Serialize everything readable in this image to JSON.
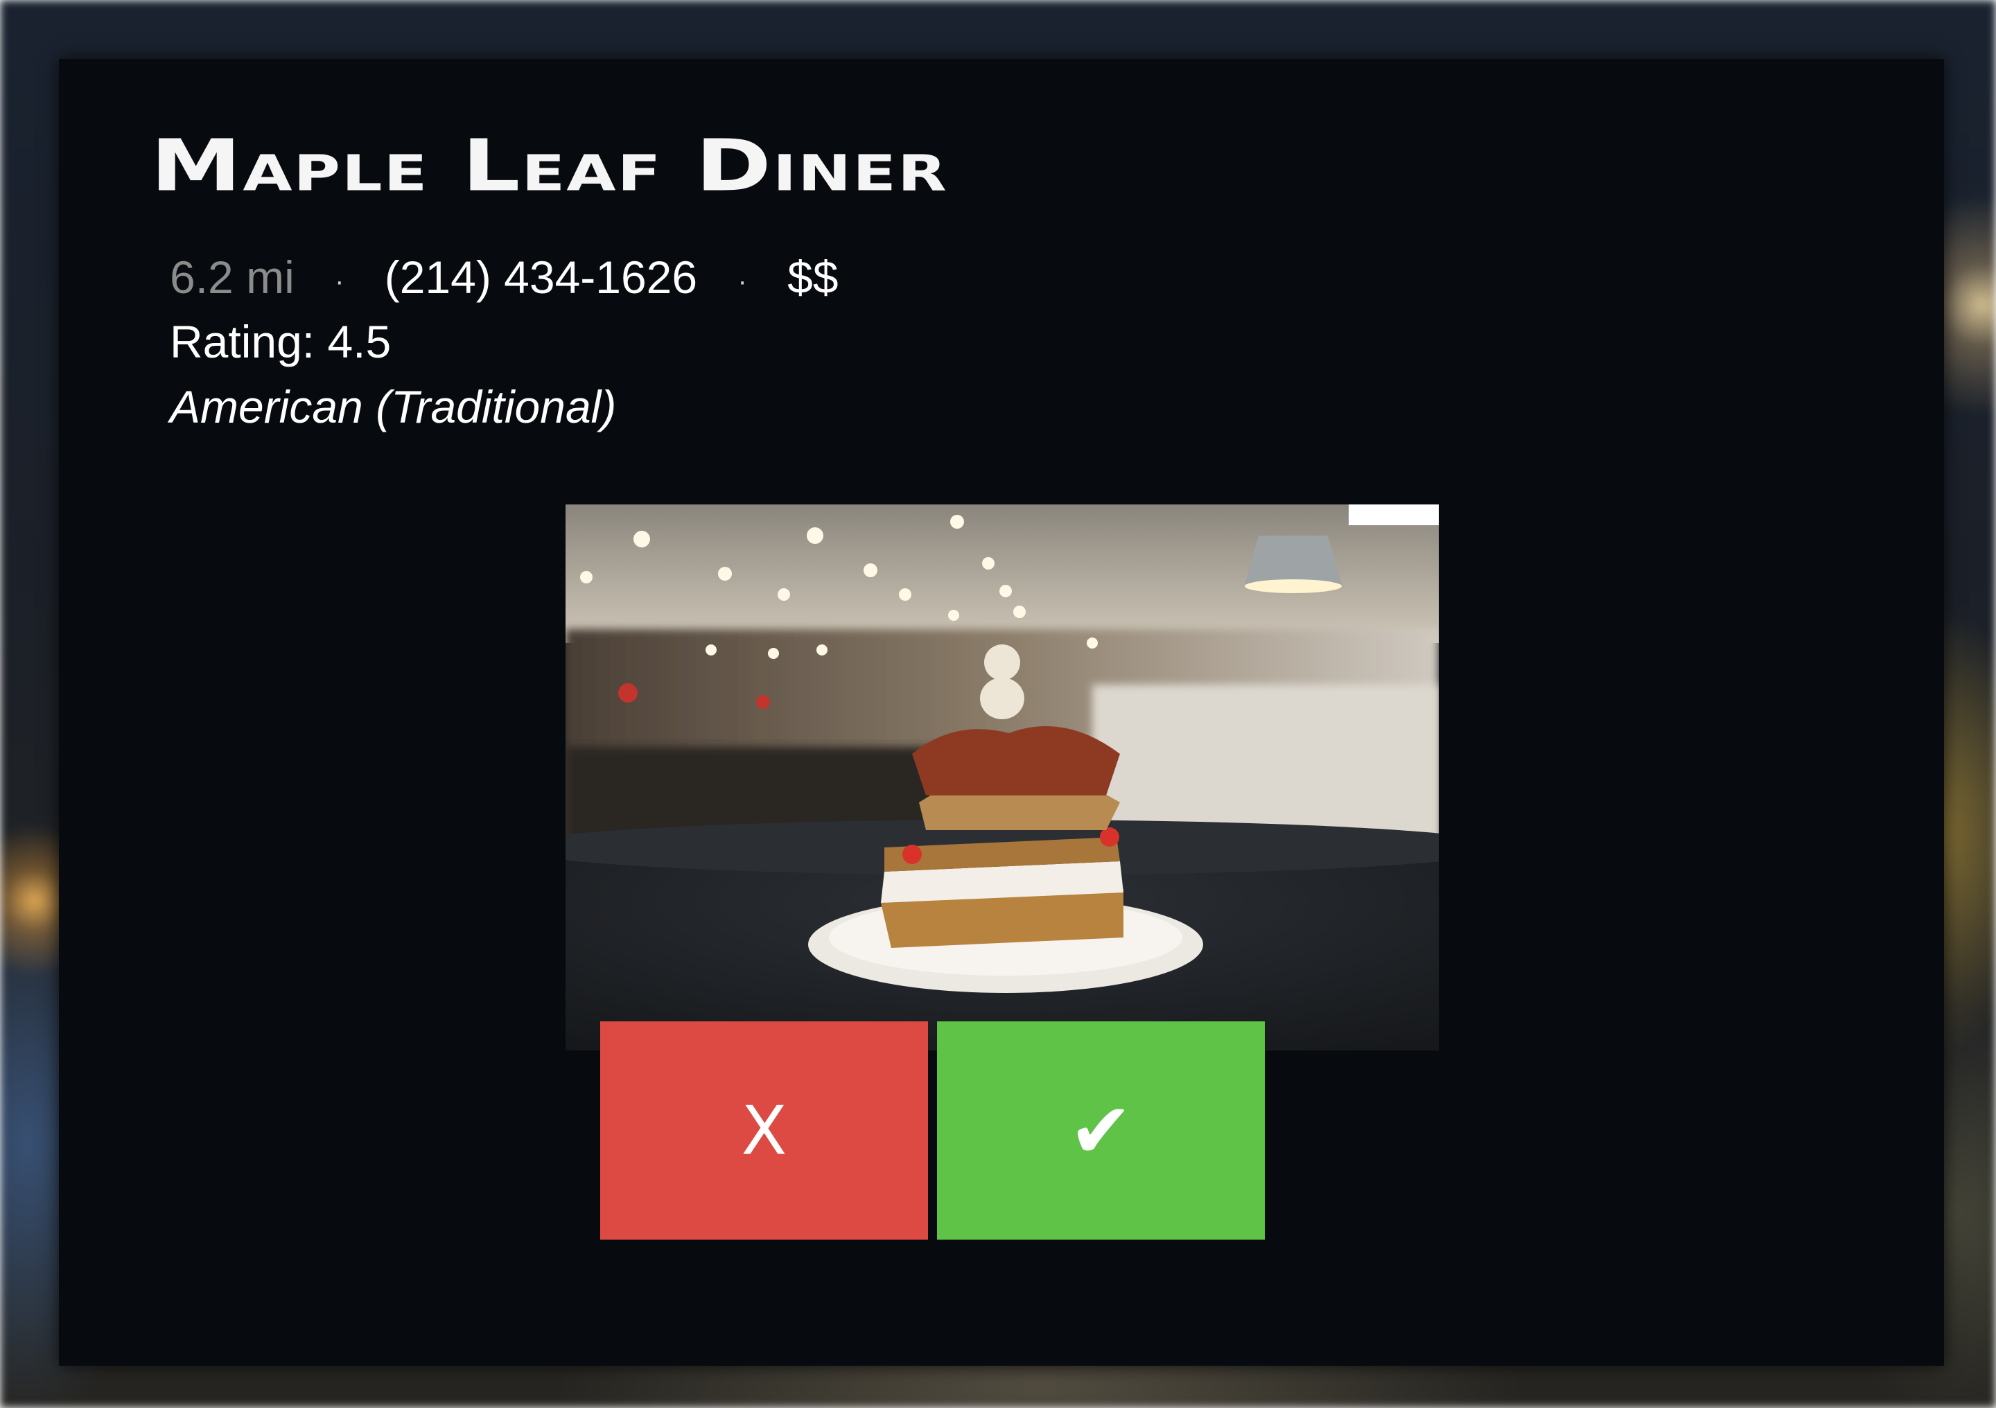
{
  "restaurant": {
    "name": "Maple Leaf Diner",
    "distance": "6.2 mi",
    "separator": "·",
    "phone": "(214) 434-1626",
    "price": "$$",
    "rating": "Rating: 4.5",
    "cuisine": "American (Traditional)",
    "photo_icon": "restaurant-photo"
  },
  "actions": {
    "reject_label": "X",
    "accept_label": "✔",
    "reject_color": "#dc4a43",
    "accept_color": "#5ec346"
  }
}
